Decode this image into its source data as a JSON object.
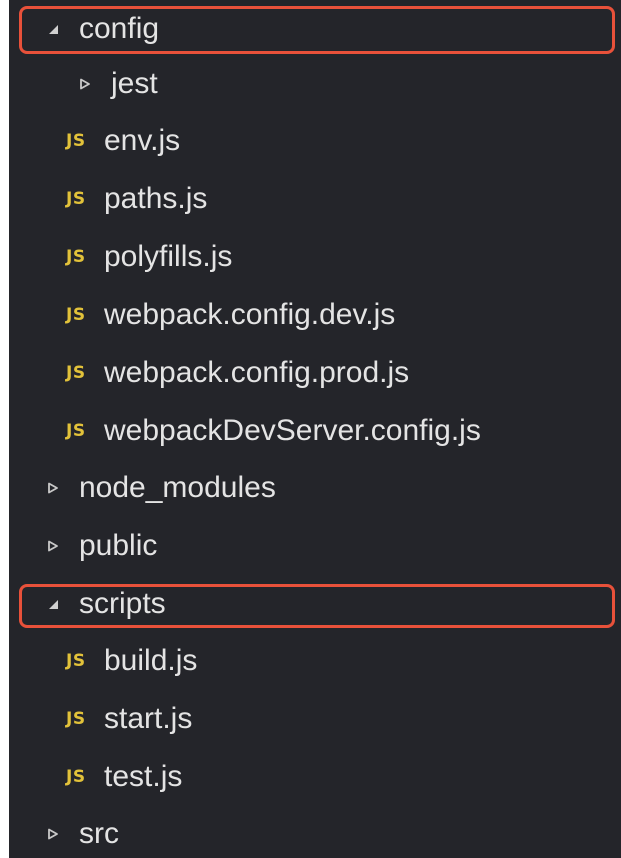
{
  "tree": {
    "items": [
      {
        "id": "config",
        "label": "config",
        "type": "folder",
        "expanded": true,
        "depth": 0,
        "icon": "triangle-down-icon"
      },
      {
        "id": "jest",
        "label": "jest",
        "type": "folder",
        "expanded": false,
        "depth": 1,
        "icon": "triangle-right-icon"
      },
      {
        "id": "env-js",
        "label": "env.js",
        "type": "file",
        "depth": 1,
        "icon": "js-file-icon",
        "icon_text": "JS"
      },
      {
        "id": "paths-js",
        "label": "paths.js",
        "type": "file",
        "depth": 1,
        "icon": "js-file-icon",
        "icon_text": "JS"
      },
      {
        "id": "polyfills-js",
        "label": "polyfills.js",
        "type": "file",
        "depth": 1,
        "icon": "js-file-icon",
        "icon_text": "JS"
      },
      {
        "id": "webpack-config-dev-js",
        "label": "webpack.config.dev.js",
        "type": "file",
        "depth": 1,
        "icon": "js-file-icon",
        "icon_text": "JS"
      },
      {
        "id": "webpack-config-prod-js",
        "label": "webpack.config.prod.js",
        "type": "file",
        "depth": 1,
        "icon": "js-file-icon",
        "icon_text": "JS"
      },
      {
        "id": "webpackdevserver-config-js",
        "label": "webpackDevServer.config.js",
        "type": "file",
        "depth": 1,
        "icon": "js-file-icon",
        "icon_text": "JS"
      },
      {
        "id": "node-modules",
        "label": "node_modules",
        "type": "folder",
        "expanded": false,
        "depth": 0,
        "icon": "triangle-right-icon"
      },
      {
        "id": "public",
        "label": "public",
        "type": "folder",
        "expanded": false,
        "depth": 0,
        "icon": "triangle-right-icon"
      },
      {
        "id": "scripts",
        "label": "scripts",
        "type": "folder",
        "expanded": true,
        "depth": 0,
        "icon": "triangle-down-icon"
      },
      {
        "id": "build-js",
        "label": "build.js",
        "type": "file",
        "depth": 1,
        "icon": "js-file-icon",
        "icon_text": "JS"
      },
      {
        "id": "start-js",
        "label": "start.js",
        "type": "file",
        "depth": 1,
        "icon": "js-file-icon",
        "icon_text": "JS"
      },
      {
        "id": "test-js",
        "label": "test.js",
        "type": "file",
        "depth": 1,
        "icon": "js-file-icon",
        "icon_text": "JS"
      },
      {
        "id": "src",
        "label": "src",
        "type": "folder",
        "expanded": false,
        "depth": 0,
        "icon": "triangle-right-icon"
      }
    ]
  },
  "highlighted_items": [
    "config",
    "scripts"
  ],
  "colors": {
    "background": "#24252a",
    "text": "#e4e4e4",
    "js_icon": "#e2c23a",
    "highlight_border": "#e8513a",
    "twisty": "#c8c8c8"
  }
}
